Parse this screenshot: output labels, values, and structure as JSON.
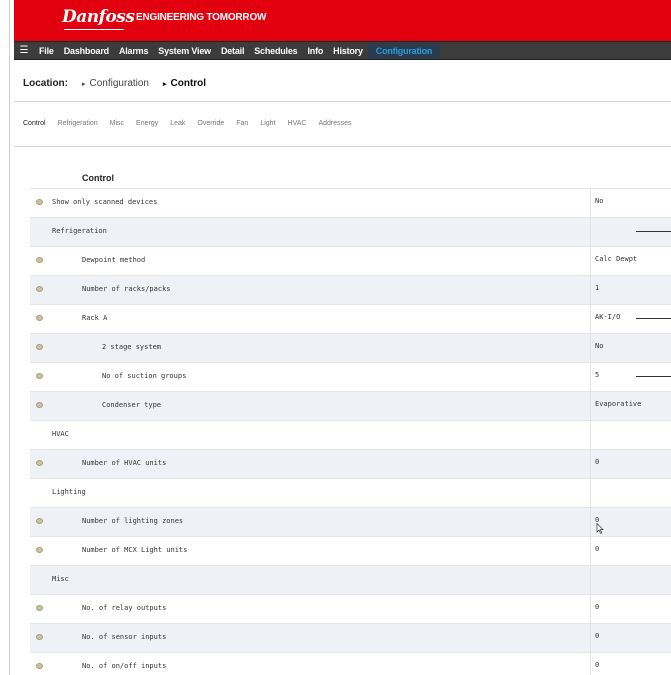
{
  "header": {
    "brand": "Danfoss",
    "tagline": "ENGINEERING TOMORROW"
  },
  "menu": {
    "items": [
      {
        "label": "File"
      },
      {
        "label": "Dashboard"
      },
      {
        "label": "Alarms"
      },
      {
        "label": "System View"
      },
      {
        "label": "Detail"
      },
      {
        "label": "Schedules"
      },
      {
        "label": "Info"
      },
      {
        "label": "History"
      },
      {
        "label": "Configuration",
        "active": true
      }
    ]
  },
  "location": {
    "label": "Location:",
    "crumbs": [
      "Configuration",
      "Control"
    ]
  },
  "tabs": [
    "Control",
    "Refrigeration",
    "Misc",
    "Energy",
    "Leak",
    "Override",
    "Fan",
    "Light",
    "HVAC",
    "Addresses"
  ],
  "table": {
    "title": "Control",
    "rows": [
      {
        "label": "Show only scanned devices",
        "value": "No",
        "indent": 0,
        "dot": true,
        "shade": false
      },
      {
        "label": "Refrigeration",
        "value": "",
        "indent": 0,
        "dot": false,
        "shade": true,
        "line": true
      },
      {
        "label": "Dewpoint method",
        "value": "Calc Dewpt",
        "indent": 1,
        "dot": true,
        "shade": false
      },
      {
        "label": "Number of racks/packs",
        "value": "1",
        "indent": 1,
        "dot": true,
        "shade": true
      },
      {
        "label": "Rack A",
        "value": "AK-I/O",
        "indent": 1,
        "dot": true,
        "shade": false,
        "line": true
      },
      {
        "label": "2 stage system",
        "value": "No",
        "indent": 2,
        "dot": true,
        "shade": true
      },
      {
        "label": "No of suction groups",
        "value": "5",
        "indent": 2,
        "dot": true,
        "shade": false,
        "line": true
      },
      {
        "label": "Condenser type",
        "value": "Evaporative",
        "indent": 2,
        "dot": true,
        "shade": true
      },
      {
        "label": "HVAC",
        "value": "",
        "indent": 0,
        "dot": false,
        "shade": false
      },
      {
        "label": "Number of HVAC units",
        "value": "0",
        "indent": 1,
        "dot": true,
        "shade": true
      },
      {
        "label": "Lighting",
        "value": "",
        "indent": 0,
        "dot": false,
        "shade": false
      },
      {
        "label": "Number of lighting zones",
        "value": "0",
        "indent": 1,
        "dot": true,
        "shade": true
      },
      {
        "label": "Number of MCX Light units",
        "value": "0",
        "indent": 1,
        "dot": true,
        "shade": false
      },
      {
        "label": "Misc",
        "value": "",
        "indent": 0,
        "dot": false,
        "shade": true
      },
      {
        "label": "No. of relay outputs",
        "value": "0",
        "indent": 1,
        "dot": true,
        "shade": false
      },
      {
        "label": "No. of sensor inputs",
        "value": "0",
        "indent": 1,
        "dot": true,
        "shade": true
      },
      {
        "label": "No. of on/off inputs",
        "value": "0",
        "indent": 1,
        "dot": true,
        "shade": false
      }
    ]
  }
}
